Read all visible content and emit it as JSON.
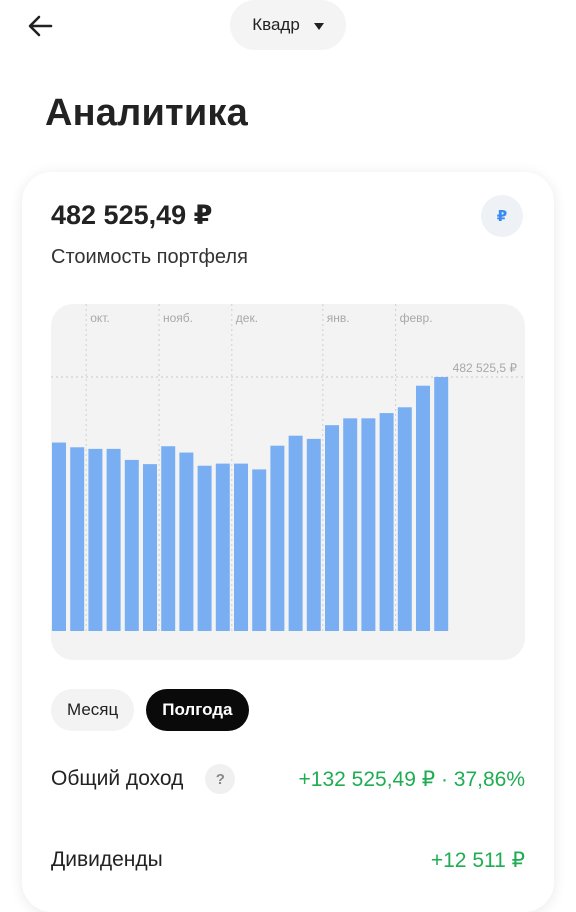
{
  "header": {
    "account_label": "Квадр"
  },
  "page": {
    "title": "Аналитика"
  },
  "portfolio": {
    "value": "482 525,49 ₽",
    "label": "Стоимость портфеля",
    "currency_symbol": "₽"
  },
  "chart_data": {
    "type": "bar",
    "color": "#7aaef3",
    "month_labels": [
      "окт.",
      "нояб.",
      "дек.",
      "янв.",
      "февр."
    ],
    "month_start_bar_index": [
      1,
      5,
      9,
      14,
      18
    ],
    "reference_label": "482 525,5 ₽",
    "reference_value": 482525.5,
    "ylim": [
      0,
      482525.5
    ],
    "values": [
      358000,
      349000,
      346000,
      346000,
      325000,
      317000,
      351000,
      339000,
      314000,
      318000,
      318000,
      307000,
      352000,
      371000,
      365000,
      391000,
      404000,
      404000,
      414000,
      425000,
      466000,
      482525.5
    ]
  },
  "periods": {
    "month": "Месяц",
    "halfyear": "Полгода"
  },
  "stats": {
    "total_income_label": "Общий доход",
    "total_income_value": "+132 525,49 ₽ · 37,86%",
    "dividends_label": "Дивиденды",
    "dividends_value": "+12 511 ₽",
    "help_symbol": "?"
  }
}
